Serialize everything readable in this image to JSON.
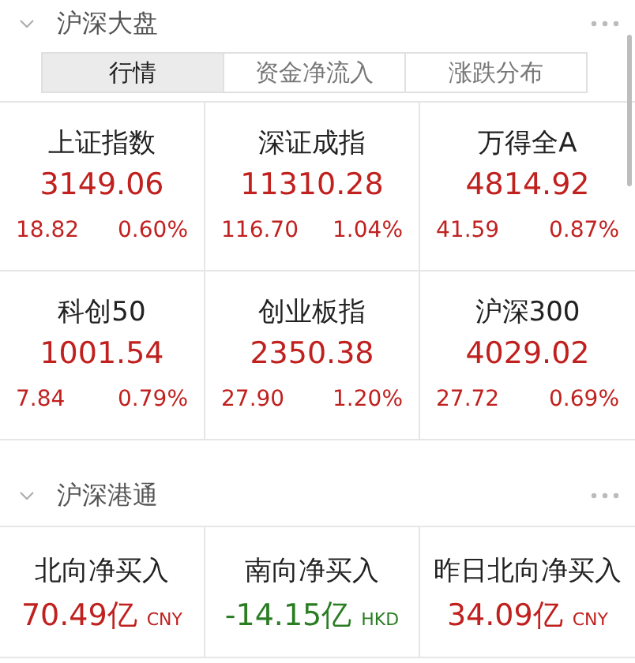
{
  "market_section": {
    "title": "沪深大盘",
    "expanded": true,
    "tabs": [
      {
        "label": "行情",
        "selected": true
      },
      {
        "label": "资金净流入",
        "selected": false
      },
      {
        "label": "涨跌分布",
        "selected": false
      }
    ],
    "indices": [
      {
        "name": "上证指数",
        "value": "3149.06",
        "change": "18.82",
        "percent": "0.60%",
        "color": "#c0211f"
      },
      {
        "name": "深证成指",
        "value": "11310.28",
        "change": "116.70",
        "percent": "1.04%",
        "color": "#c0211f"
      },
      {
        "name": "万得全A",
        "value": "4814.92",
        "change": "41.59",
        "percent": "0.87%",
        "color": "#c0211f"
      },
      {
        "name": "科创50",
        "value": "1001.54",
        "change": "7.84",
        "percent": "0.79%",
        "color": "#c0211f"
      },
      {
        "name": "创业板指",
        "value": "2350.38",
        "change": "27.90",
        "percent": "1.20%",
        "color": "#c0211f"
      },
      {
        "name": "沪深300",
        "value": "4029.02",
        "change": "27.72",
        "percent": "0.69%",
        "color": "#c0211f"
      }
    ]
  },
  "connect_section": {
    "title": "沪深港通",
    "expanded": true,
    "flows": [
      {
        "name": "北向净买入",
        "value": "70.49亿",
        "unit": "CNY",
        "color": "#c0211f"
      },
      {
        "name": "南向净买入",
        "value": "-14.15亿",
        "unit": "HKD",
        "color": "#2a7d22"
      },
      {
        "name": "昨日北向净买入",
        "value": "34.09亿",
        "unit": "CNY",
        "color": "#c0211f"
      }
    ]
  }
}
